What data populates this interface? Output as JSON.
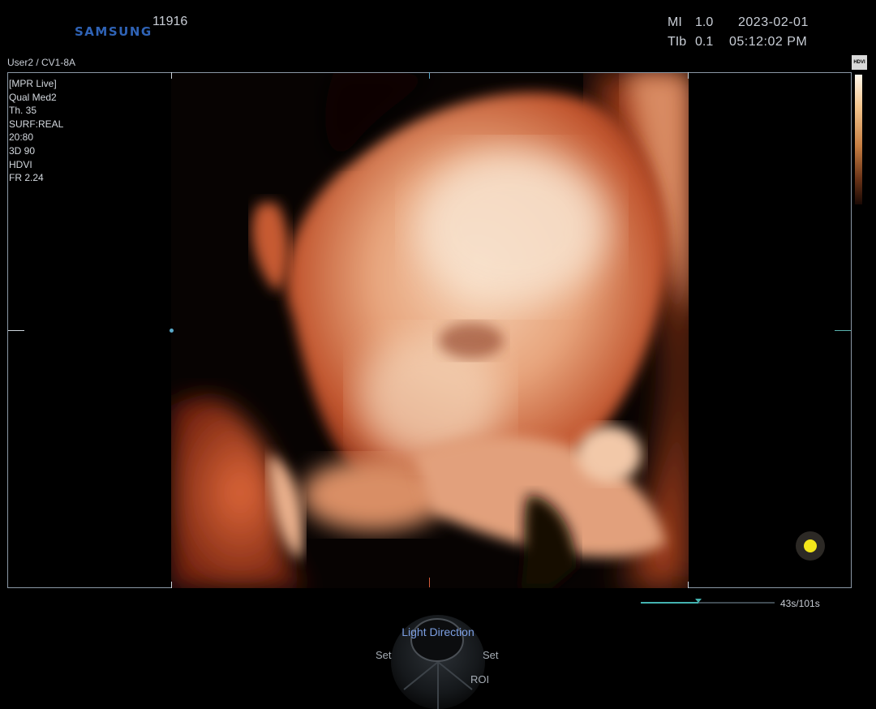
{
  "header": {
    "brand": "SAMSUNG",
    "patient_id": "11916",
    "mi_label": "MI",
    "mi_value": "1.0",
    "tib_label": "TIb",
    "tib_value": "0.1",
    "date": "2023-02-01",
    "time": "05:12:02 PM"
  },
  "probe": "User2 / CV1-8A",
  "parameters": [
    "[MPR Live]",
    "Qual Med2",
    "Th. 35",
    "SURF:REAL",
    "20:80",
    "3D 90",
    "HDVI",
    "FR 2.24"
  ],
  "colorbar": {
    "label": "HDVI"
  },
  "cine": {
    "time": "43s/101s",
    "progress": 0.43
  },
  "indicator": {
    "color": "#f3e61a"
  },
  "control": {
    "title": "Light Direction",
    "left_label": "Set",
    "right_label": "Set",
    "bottom_label": "ROI"
  },
  "colors": {
    "frame": "#8b98a6",
    "accent_teal": "#44b3b0",
    "brand_blue": "#2f63b6"
  },
  "image": {
    "description_icon": "3d-ultrasound-render"
  }
}
